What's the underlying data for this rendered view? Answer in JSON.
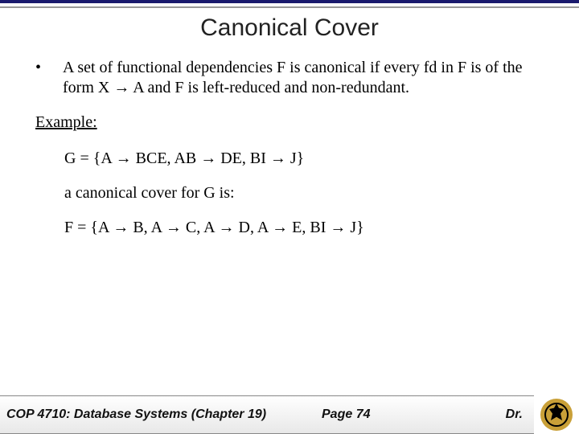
{
  "title": "Canonical Cover",
  "bullet": {
    "mark": "•",
    "text": "A set of functional dependencies F is canonical if every fd in F is of the form X → A and F is left-reduced and non-redundant."
  },
  "example": {
    "label": "Example:",
    "g": "G = {A → BCE,  AB → DE,  BI → J}",
    "desc": "a canonical cover for G is:",
    "f": "F = {A → B, A → C, A → D, A → E, BI → J}"
  },
  "footer": {
    "course": "COP 4710: Database Systems  (Chapter 19)",
    "page": "Page 74",
    "author": "Dr."
  }
}
